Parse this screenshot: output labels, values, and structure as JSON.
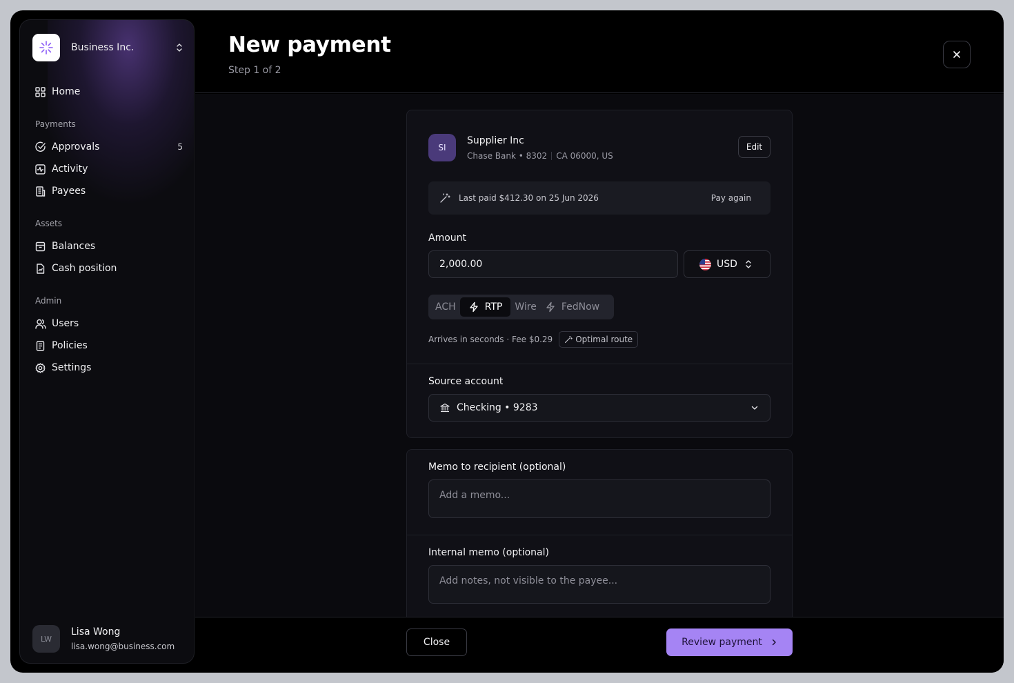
{
  "org": {
    "name": "Business Inc."
  },
  "nav": {
    "home": "Home",
    "payments_label": "Payments",
    "approvals": "Approvals",
    "approvals_count": "5",
    "activity": "Activity",
    "payees": "Payees",
    "assets_label": "Assets",
    "balances": "Balances",
    "cash_position": "Cash position",
    "admin_label": "Admin",
    "users": "Users",
    "policies": "Policies",
    "settings": "Settings"
  },
  "user": {
    "initials": "LW",
    "name": "Lisa Wong",
    "email": "lisa.wong@business.com"
  },
  "header": {
    "title": "New payment",
    "step": "Step 1 of 2"
  },
  "payee": {
    "initials": "SI",
    "name": "Supplier Inc",
    "bank": "Chase Bank • 8302",
    "location": "CA 06000, US",
    "edit_label": "Edit"
  },
  "last_paid": {
    "text": "Last paid $412.30 on 25 Jun 2026",
    "action": "Pay again"
  },
  "amount": {
    "label": "Amount",
    "value": "2,000.00",
    "currency": "USD"
  },
  "rails": {
    "ach": "ACH",
    "rtp": "RTP",
    "wire": "Wire",
    "fednow": "FedNow",
    "selected": "RTP"
  },
  "rail_info": {
    "text": "Arrives in seconds · Fee $0.29",
    "badge": "Optimal route"
  },
  "source": {
    "label": "Source account",
    "value": "Checking • 9283"
  },
  "memo": {
    "label": "Memo to recipient (optional)",
    "placeholder": "Add a memo..."
  },
  "internal_memo": {
    "label": "Internal memo (optional)",
    "placeholder": "Add notes, not visible to the payee..."
  },
  "footer": {
    "close": "Close",
    "review": "Review payment"
  },
  "colors": {
    "accent": "#a584f4",
    "background": "#000000",
    "surface": "#101016"
  }
}
